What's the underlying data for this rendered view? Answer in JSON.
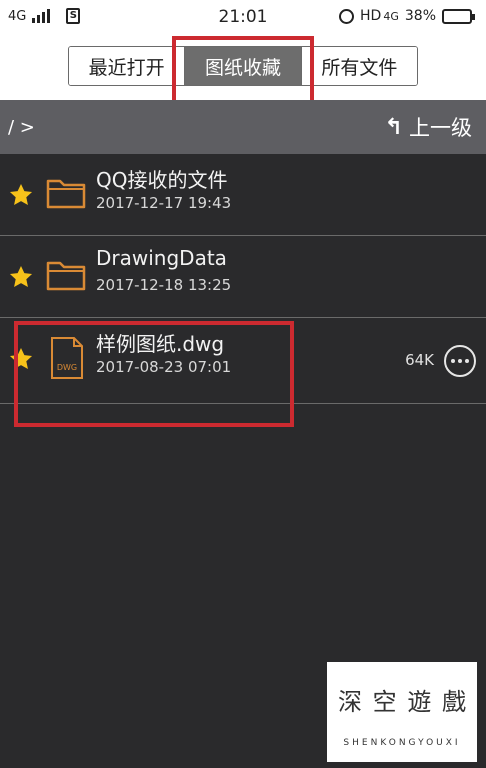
{
  "status_bar": {
    "network": "4G",
    "time": "21:01",
    "hd": "HD",
    "hd_net": "4G",
    "battery": "38%",
    "battery_level": 0.38
  },
  "tabs": [
    {
      "label": "最近打开",
      "active": false
    },
    {
      "label": "图纸收藏",
      "active": true
    },
    {
      "label": "所有文件",
      "active": false
    }
  ],
  "path": {
    "current": "/ >",
    "up_label": "上一级"
  },
  "files": [
    {
      "name": "QQ接收的文件",
      "date": "2017-12-17 19:43",
      "type": "folder",
      "icon": "folder-icon",
      "starred": true
    },
    {
      "name": "DrawingData",
      "date": "2017-12-18 13:25",
      "type": "folder",
      "icon": "folder-icon",
      "starred": true
    },
    {
      "name": "样例图纸.dwg",
      "date": "2017-08-23 07:01",
      "type": "dwg",
      "icon": "dwg-file-icon",
      "size": "64K",
      "dwg_label": "DWG",
      "starred": true
    }
  ],
  "watermark": {
    "chars": [
      "深",
      "空",
      "遊",
      "戲"
    ],
    "subtitle": "SHENKONGYOUXI"
  },
  "colors": {
    "accent_highlight": "#cc2a30",
    "star": "#f7c21a",
    "folder": "#d98a35",
    "background": "#2a2a2c",
    "path_bar": "#5e5e62"
  }
}
